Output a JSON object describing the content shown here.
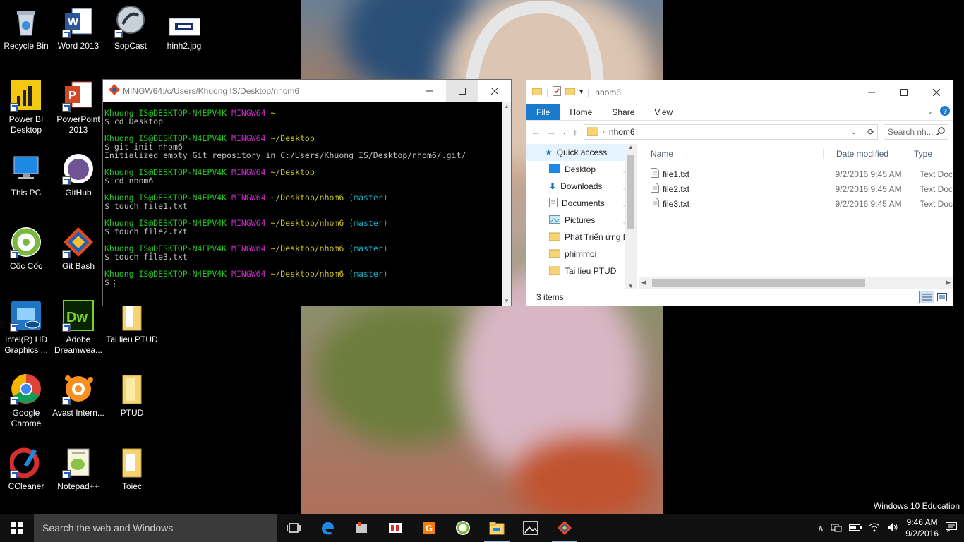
{
  "desktop": {
    "icons": [
      {
        "label": "Recycle Bin"
      },
      {
        "label": "Word 2013"
      },
      {
        "label": "SopCast"
      },
      {
        "label": "hinh2.jpg"
      },
      {
        "label": "Power BI Desktop"
      },
      {
        "label": "PowerPoint 2013"
      },
      {
        "label": "This PC"
      },
      {
        "label": "GitHub"
      },
      {
        "label": "Cốc Cốc"
      },
      {
        "label": "Git Bash"
      },
      {
        "label": "Intel(R) HD Graphics ..."
      },
      {
        "label": "Adobe Dreamwea..."
      },
      {
        "label": "Tai lieu PTUD"
      },
      {
        "label": "Google Chrome"
      },
      {
        "label": "Avast Intern..."
      },
      {
        "label": "PTUD"
      },
      {
        "label": "CCleaner"
      },
      {
        "label": "Notepad++"
      },
      {
        "label": "Toiec"
      }
    ]
  },
  "terminal": {
    "title": "MINGW64:/c/Users/Khuong IS/Desktop/nhom6",
    "user": "Khuong IS@DESKTOP-N4EPV4K",
    "shell": "MINGW64",
    "branch": "(master)",
    "prompt": "$",
    "blocks": [
      {
        "path": "~",
        "cmd": "cd Desktop",
        "out": ""
      },
      {
        "path": "~/Desktop",
        "cmd": "git init nhom6",
        "out": "Initialized empty Git repository in C:/Users/Khuong IS/Desktop/nhom6/.git/"
      },
      {
        "path": "~/Desktop",
        "cmd": "cd nhom6",
        "out": ""
      },
      {
        "path": "~/Desktop/nhom6",
        "cmd": "touch file1.txt",
        "out": ""
      },
      {
        "path": "~/Desktop/nhom6",
        "cmd": "touch file2.txt",
        "out": ""
      },
      {
        "path": "~/Desktop/nhom6",
        "cmd": "touch file3.txt",
        "out": ""
      },
      {
        "path": "~/Desktop/nhom6",
        "cmd": "",
        "out": ""
      }
    ]
  },
  "explorer": {
    "title": "nhom6",
    "ribbon": {
      "file": "File",
      "home": "Home",
      "share": "Share",
      "view": "View"
    },
    "address": "nhom6",
    "search_placeholder": "Search nh...",
    "nav": {
      "quick_access": "Quick access",
      "items": [
        "Desktop",
        "Downloads",
        "Documents",
        "Pictures",
        "Phát Triển ứng D",
        "phimmoi",
        "Tai lieu PTUD"
      ]
    },
    "columns": {
      "name": "Name",
      "date": "Date modified",
      "type": "Type"
    },
    "files": [
      {
        "name": "file1.txt",
        "date": "9/2/2016 9:45 AM",
        "type": "Text Doc"
      },
      {
        "name": "file2.txt",
        "date": "9/2/2016 9:45 AM",
        "type": "Text Doc"
      },
      {
        "name": "file3.txt",
        "date": "9/2/2016 9:45 AM",
        "type": "Text Doc"
      }
    ],
    "status": "3 items"
  },
  "taskbar": {
    "search_placeholder": "Search the web and Windows",
    "time": "9:46 AM",
    "date": "9/2/2016"
  },
  "watermark": "Windows 10 Education",
  "colors": {
    "term_green": "#21c721",
    "term_magenta": "#c829c8",
    "term_yellow": "#c9c21f",
    "term_cyan": "#19b1c4",
    "explorer_accent": "#1979ca"
  }
}
